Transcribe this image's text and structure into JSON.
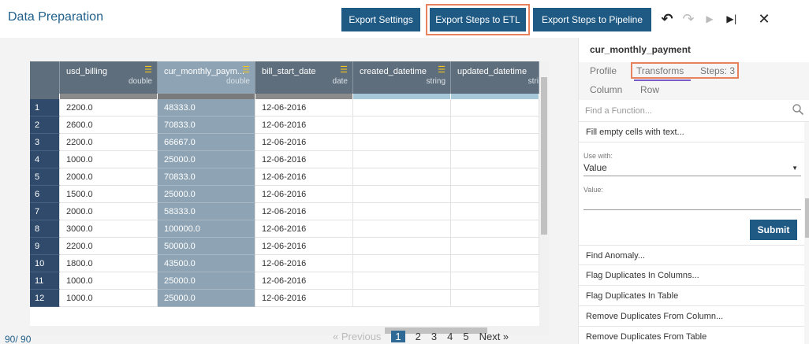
{
  "header": {
    "title": "Data Preparation",
    "export_settings": "Export Settings",
    "export_etl": "Export Steps to ETL",
    "export_pipeline": "Export Steps to Pipeline"
  },
  "grid": {
    "columns": [
      {
        "name": "usd_billing",
        "type": "double"
      },
      {
        "name": "cur_monthly_paym...",
        "type": "double"
      },
      {
        "name": "bill_start_date",
        "type": "date"
      },
      {
        "name": "created_datetime",
        "type": "string"
      },
      {
        "name": "updated_datetime",
        "type": "stri"
      }
    ],
    "rows": [
      {
        "idx": "1",
        "c0": "2200.0",
        "c1": "48333.0",
        "c2": "12-06-2016"
      },
      {
        "idx": "2",
        "c0": "2600.0",
        "c1": "70833.0",
        "c2": "12-06-2016"
      },
      {
        "idx": "3",
        "c0": "2200.0",
        "c1": "66667.0",
        "c2": "12-06-2016"
      },
      {
        "idx": "4",
        "c0": "1000.0",
        "c1": "25000.0",
        "c2": "12-06-2016"
      },
      {
        "idx": "5",
        "c0": "2000.0",
        "c1": "70833.0",
        "c2": "12-06-2016"
      },
      {
        "idx": "6",
        "c0": "1500.0",
        "c1": "25000.0",
        "c2": "12-06-2016"
      },
      {
        "idx": "7",
        "c0": "2000.0",
        "c1": "58333.0",
        "c2": "12-06-2016"
      },
      {
        "idx": "8",
        "c0": "3000.0",
        "c1": "100000.0",
        "c2": "12-06-2016"
      },
      {
        "idx": "9",
        "c0": "2200.0",
        "c1": "50000.0",
        "c2": "12-06-2016"
      },
      {
        "idx": "10",
        "c0": "1800.0",
        "c1": "43500.0",
        "c2": "12-06-2016"
      },
      {
        "idx": "11",
        "c0": "1000.0",
        "c1": "25000.0",
        "c2": "12-06-2016"
      },
      {
        "idx": "12",
        "c0": "1000.0",
        "c1": "25000.0",
        "c2": "12-06-2016"
      }
    ],
    "row_count": "90/ 90"
  },
  "pager": {
    "previous": "« Previous",
    "pages": [
      "1",
      "2",
      "3",
      "4",
      "5"
    ],
    "next": "Next »"
  },
  "panel": {
    "title": "cur_monthly_payment",
    "tabs": [
      "Profile",
      "Transforms",
      "Steps: 3"
    ],
    "subtabs": [
      "Column",
      "Row"
    ],
    "search_placeholder": "Find a Function...",
    "functions_top": [
      "Fill empty cells with text..."
    ],
    "form": {
      "use_with_label": "Use with:",
      "use_with_value": "Value",
      "value_label": "Value:",
      "submit": "Submit"
    },
    "functions_bottom": [
      "Find Anomaly...",
      "Flag Duplicates In Columns...",
      "Flag Duplicates In Table",
      "Remove Duplicates From Column...",
      "Remove Duplicates From Table"
    ]
  },
  "colors": {
    "accent": "#1f5a85",
    "highlight": "#e8825d",
    "selected_column": "#8ea4b4",
    "header": "#5f6e7c",
    "index": "#2f4a6a"
  }
}
